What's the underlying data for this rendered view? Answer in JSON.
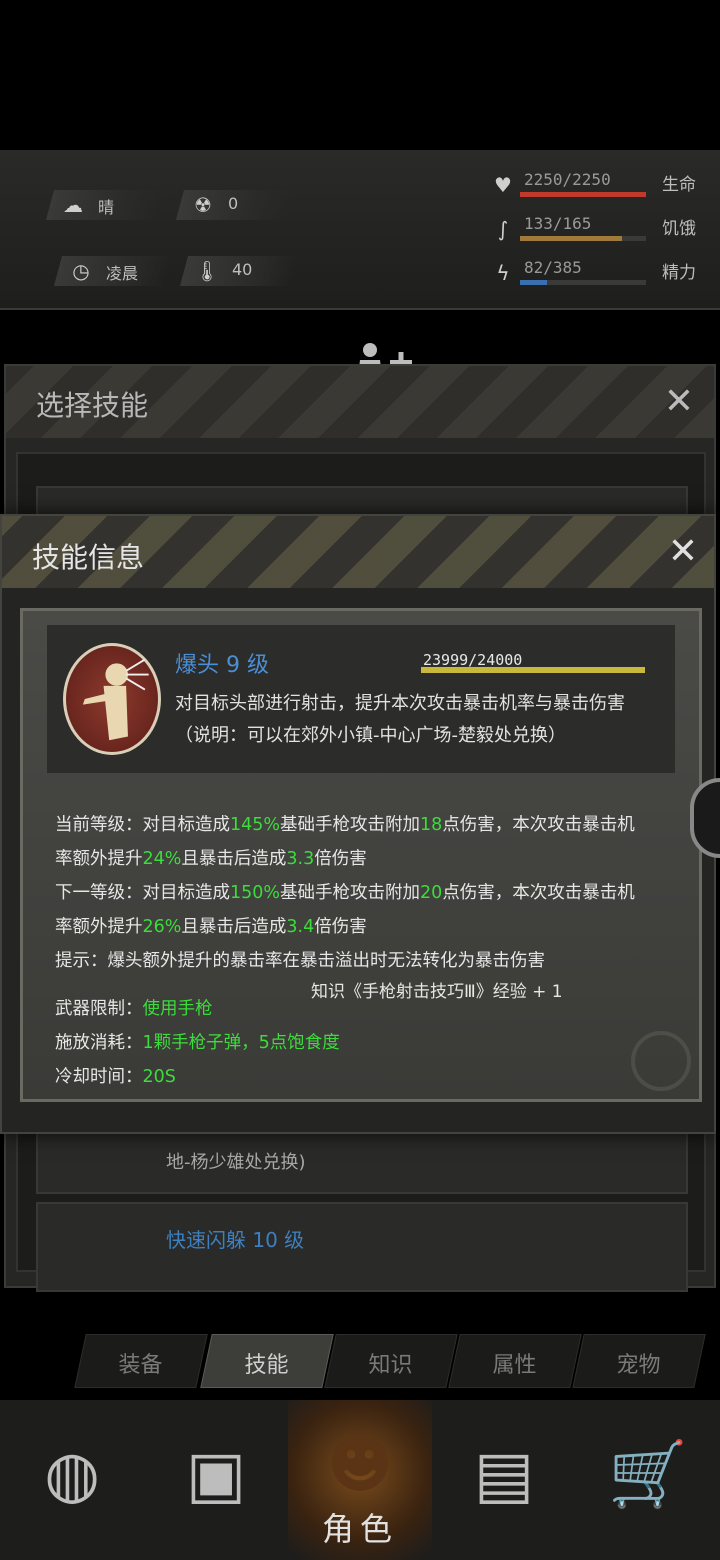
{
  "status": {
    "weather": "晴",
    "radiation": "0",
    "time_of_day": "凌晨",
    "temperature": "40",
    "vitals": [
      {
        "value": "2250/2250",
        "label": "生命",
        "fill": 1.0,
        "color": "#c0392b",
        "icon": "heart-icon"
      },
      {
        "value": "133/165",
        "label": "饥饿",
        "fill": 0.806,
        "color": "#a07a3a",
        "icon": "stomach-icon"
      },
      {
        "value": "82/385",
        "label": "精力",
        "fill": 0.213,
        "color": "#3a6fb0",
        "icon": "energy-icon"
      }
    ]
  },
  "skill_select": {
    "title": "选择技能",
    "items": [
      {
        "name": "爆头 9 级"
      },
      {
        "desc": "地-杨少雄处兑换)"
      },
      {
        "name": "快速闪躲 10 级"
      }
    ]
  },
  "skill_info": {
    "title": "技能信息",
    "name": "爆头 9 级",
    "exp_text": "23999/24000",
    "exp_fill": 0.99996,
    "desc": "对目标头部进行射击，提升本次攻击暴击机率与暴击伤害",
    "note": "（说明：可以在郊外小镇-中心广场-楚毅处兑换）",
    "current": {
      "label": "当前等级：对目标造成",
      "pct": "145%",
      "mid1": "基础手枪攻击附加",
      "dmg": "18",
      "mid2": "点伤害，本次攻击暴击机",
      "line2a": "率额外提升",
      "crit": "24%",
      "line2b": "且暴击后造成",
      "mult": "3.3",
      "line2c": "倍伤害"
    },
    "next": {
      "label": "下一等级：对目标造成",
      "pct": "150%",
      "mid1": "基础手枪攻击附加",
      "dmg": "20",
      "mid2": "点伤害，本次攻击暴击机",
      "line2a": "率额外提升",
      "crit": "26%",
      "line2b": "且暴击后造成",
      "mult": "3.4",
      "line2c": "倍伤害"
    },
    "tip": "提示：爆头额外提升的暴击率在暴击溢出时无法转化为暴击伤害",
    "knowledge": "知识《手枪射击技巧Ⅲ》经验 + 1",
    "weapon_label": "武器限制：",
    "weapon_value": "使用手枪",
    "cost_label": "施放消耗：",
    "cost_value": "1颗手枪子弹，5点饱食度",
    "cooldown_label": "冷却时间：",
    "cooldown_value": "20S"
  },
  "tabs": [
    {
      "label": "装备",
      "active": false
    },
    {
      "label": "技能",
      "active": true
    },
    {
      "label": "知识",
      "active": false
    },
    {
      "label": "属性",
      "active": false
    },
    {
      "label": "宠物",
      "active": false
    }
  ],
  "bottom_nav": [
    {
      "icon": "globe-icon",
      "label": ""
    },
    {
      "icon": "backpack-icon",
      "label": ""
    },
    {
      "icon": "character-icon",
      "label": "角色",
      "active": true
    },
    {
      "icon": "radio-icon",
      "label": ""
    },
    {
      "icon": "cart-icon",
      "label": ""
    }
  ]
}
